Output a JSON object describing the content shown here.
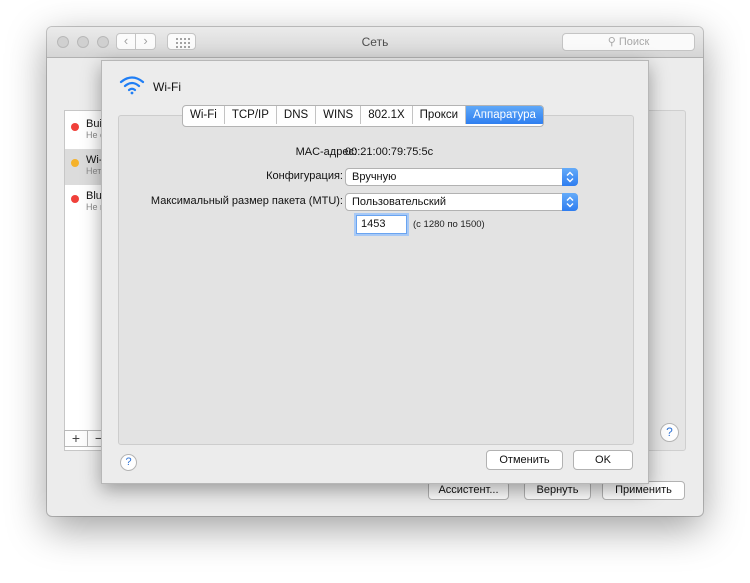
{
  "window": {
    "title": "Сеть",
    "search_placeholder": "Поиск",
    "back_glyph": "‹",
    "forward_glyph": "›"
  },
  "services": [
    {
      "name": "Buil",
      "status": "Не с",
      "dot_color": "#f0403a"
    },
    {
      "name": "Wi-",
      "status": "Нет",
      "dot_color": "#f5b22a"
    },
    {
      "name": "Blu",
      "status": "Не п",
      "dot_color": "#f0403a"
    }
  ],
  "list_controls": {
    "plus": "+",
    "minus": "−"
  },
  "main_buttons": {
    "assistant": "Ассистент...",
    "revert": "Вернуть",
    "apply": "Применить",
    "help": "?"
  },
  "sheet": {
    "title": "Wi-Fi",
    "tabs": [
      "Wi-Fi",
      "TCP/IP",
      "DNS",
      "WINS",
      "802.1X",
      "Прокси",
      "Аппаратура"
    ],
    "active_tab": "Аппаратура",
    "mac_label": "MAC-адрес:",
    "mac_value": "00:21:00:79:75:5c",
    "config_label": "Конфигурация:",
    "config_value": "Вручную",
    "mtu_label": "Максимальный размер пакета (MTU):",
    "mtu_value": "Пользовательский",
    "mtu_input": "1453",
    "mtu_hint": "(с 1280 по 1500)",
    "help": "?",
    "cancel": "Отменить",
    "ok": "OK"
  },
  "colors": {
    "accent": "#2f7ff0",
    "wifi_icon": "#1f7ef5"
  }
}
